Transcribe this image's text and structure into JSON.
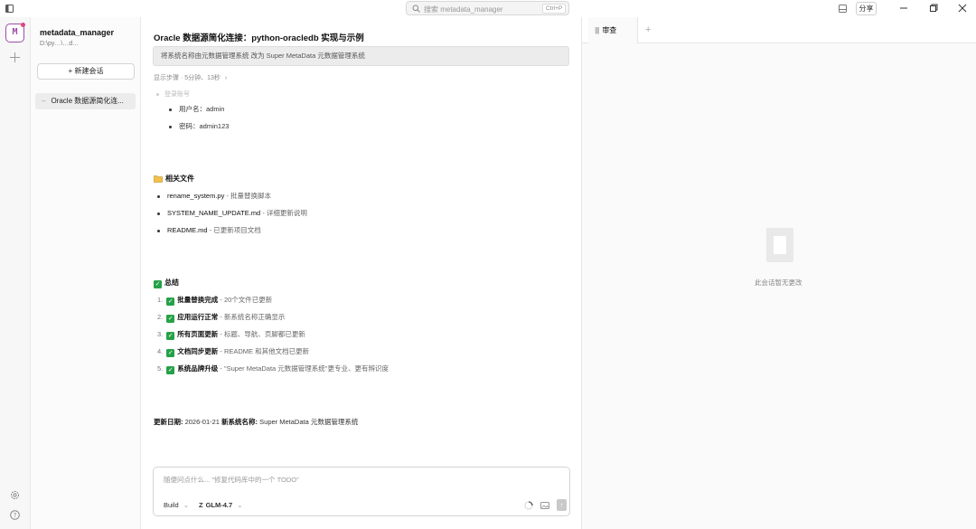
{
  "titlebar": {
    "search_placeholder": "搜索 metadata_manager",
    "search_shortcut": "Ctrl+P",
    "share_label": "分享"
  },
  "rail": {
    "avatar_letter": "M"
  },
  "sidebar": {
    "project_name": "metadata_manager",
    "project_path": "D:\\py…\\…d…",
    "new_chat_label": "+ 新建会话",
    "conversations": [
      {
        "label": "Oracle 数据源简化连..."
      }
    ]
  },
  "chat": {
    "title": "Oracle 数据源简化连接：python-oracledb 实现与示例",
    "prompt": "将系统名称由元数据管理系统 改为 Super MetaData 元数据管理系统",
    "steps": "显示步骤 · 5分钟、13秒",
    "faded_heading": "登录账号",
    "account": [
      {
        "label": "用户名",
        "value": "admin"
      },
      {
        "label": "密码",
        "value": "admin123"
      }
    ],
    "files_title": "相关文件",
    "files": [
      {
        "name": "rename_system.py",
        "desc": "批量替换脚本"
      },
      {
        "name": "SYSTEM_NAME_UPDATE.md",
        "desc": "详细更新说明"
      },
      {
        "name": "README.md",
        "desc": "已更新项目文档"
      }
    ],
    "summary_title": "总结",
    "summary": [
      {
        "num": "1.",
        "title": "批量替换完成",
        "desc": "20个文件已更新"
      },
      {
        "num": "2.",
        "title": "应用运行正常",
        "desc": "新系统名称正确显示"
      },
      {
        "num": "3.",
        "title": "所有页面更新",
        "desc": "标题、导航、页脚都已更新"
      },
      {
        "num": "4.",
        "title": "文档同步更新",
        "desc": "README 和其他文档已更新"
      },
      {
        "num": "5.",
        "title": "系统品牌升级",
        "desc": "\"Super MetaData 元数据管理系统\"更专业、更有辨识度"
      }
    ],
    "update_date_label": "更新日期:",
    "update_date": "2026-01-21",
    "new_name_label": "新系统名称:",
    "new_name": "Super MetaData 元数据管理系统",
    "composer": {
      "placeholder": "随便问点什么... \"修复代码库中的一个 TODO\"",
      "mode": "Build",
      "model": "GLM-4.7"
    }
  },
  "review": {
    "tab_label": "审查",
    "empty_text": "此会话暂无更改"
  }
}
